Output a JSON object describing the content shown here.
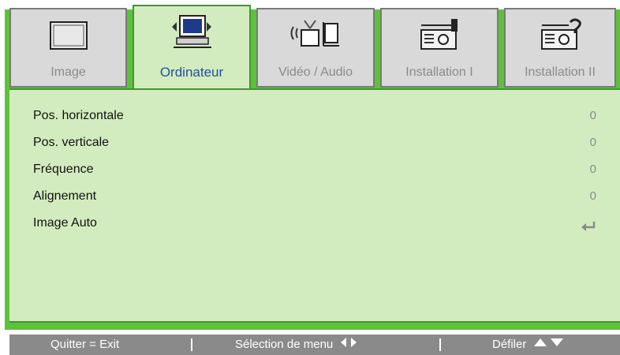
{
  "tabs": [
    {
      "label": "Image",
      "icon": "monitor-icon",
      "active": false
    },
    {
      "label": "Ordinateur",
      "icon": "computer-icon",
      "active": true
    },
    {
      "label": "Vidéo / Audio",
      "icon": "video-audio-icon",
      "active": false
    },
    {
      "label": "Installation I",
      "icon": "projector-icon",
      "active": false
    },
    {
      "label": "Installation II",
      "icon": "projector-2-icon",
      "active": false
    }
  ],
  "menu": {
    "items": [
      {
        "label": "Pos. horizontale",
        "value": "0"
      },
      {
        "label": "Pos. verticale",
        "value": "0"
      },
      {
        "label": "Fréquence",
        "value": "0"
      },
      {
        "label": "Alignement",
        "value": "0"
      },
      {
        "label": "Image Auto",
        "value_icon": "enter-icon"
      }
    ]
  },
  "footer": {
    "quit": "Quitter = Exit",
    "select": "Sélection de menu",
    "scroll": "Défiler"
  },
  "colors": {
    "frame_green": "#5bc23a",
    "panel_green": "#d3ecbf",
    "active_label": "#1f4f9e",
    "footer_gray": "#8a8a8a"
  }
}
